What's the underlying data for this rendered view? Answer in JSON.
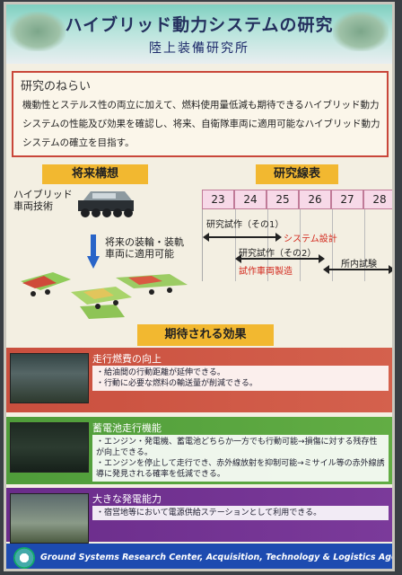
{
  "header": {
    "title": "ハイブリッド動力システムの研究",
    "subtitle": "陸上装備研究所"
  },
  "aim": {
    "title": "研究のねらい",
    "text": "機動性とステルス性の両立に加えて、燃料使用量低減も期待できるハイブリッド動力システムの性能及び効果を確認し、将来、自衛隊車両に適用可能なハイブリッド動力システムの確立を目指す。"
  },
  "future": {
    "label": "将来構想",
    "tech_label": "ハイブリッド\n車両技術",
    "apply_label": "将来の装輪・装軌\n車両に適用可能"
  },
  "schedule": {
    "label": "研究線表",
    "years": [
      "23",
      "24",
      "25",
      "26",
      "27",
      "28"
    ],
    "items": [
      {
        "text": "研究試作（その1）",
        "color": "#222222"
      },
      {
        "text": "システム設計",
        "color": "#d32a1e"
      },
      {
        "text": "研究試作（その2）",
        "color": "#222222"
      },
      {
        "text": "試作車両製造",
        "color": "#d32a1e"
      },
      {
        "text": "所内試験",
        "color": "#222222"
      }
    ]
  },
  "effects": {
    "label": "期待される効果",
    "items": [
      {
        "title": "走行燃費の向上",
        "lines": [
          "・給油間の行動距離が延伸できる。",
          "・行動に必要な燃料の輸送量が削減できる。"
        ]
      },
      {
        "title": "蓄電池走行機能",
        "lines": [
          "・エンジン・発電機、蓄電池どちらか一方でも行動可能→損傷に対する残存性が向上できる。",
          "・エンジンを停止して走行でき、赤外線放射を抑制可能→ミサイル等の赤外線誘導に発見される確率を低減できる。"
        ]
      },
      {
        "title": "大きな発電能力",
        "lines": [
          "・宿営地等において電源供給ステーションとして利用できる。"
        ]
      }
    ]
  },
  "footer": {
    "text": "Ground Systems Research Center, Acquisition, Technology & Logistics Agency (ATLA)"
  }
}
